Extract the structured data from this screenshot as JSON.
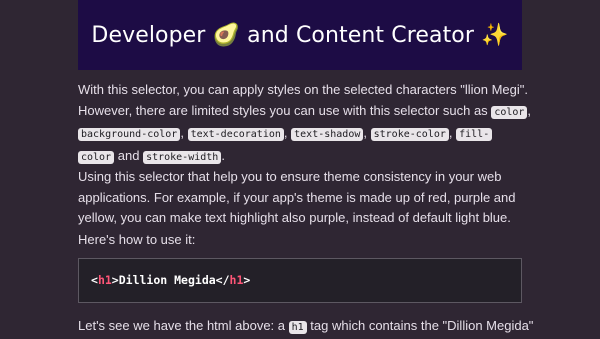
{
  "hero": {
    "title_before": "Developer",
    "emoji_avocado": "🥑",
    "title_middle": "and Content Creator",
    "emoji_sparkles": "✨"
  },
  "p1": {
    "line1": "With this selector, you can apply styles on the selected characters \"llion Megi\".",
    "line2_text": "However, there are limited styles you can use with this selector such as",
    "code_color": "color",
    "comma": ",",
    "code_bg": "background-color",
    "code_decor": "text-decoration",
    "code_shadow": "text-shadow",
    "code_stroke": "stroke-color",
    "code_fill_a": "fill-",
    "code_fill_b": "color",
    "and": "and",
    "code_stroke_width": "stroke-width",
    "period": "."
  },
  "p2": {
    "line1": "Using this selector that help you to ensure theme consistency in your web",
    "line2": "applications. For example, if your app's theme is made up of red, purple and",
    "line3": "yellow, you can make text highlight also purple, instead of default light blue."
  },
  "p3": {
    "text": "Here's how to use it:"
  },
  "code_block": {
    "open_lt": "<",
    "open_tag": "h1",
    "open_gt": ">",
    "content": "Dillion Megida",
    "close_lt": "</",
    "close_tag": "h1",
    "close_gt": ">"
  },
  "p4": {
    "text_before": "Let's see we have the html above: a",
    "code_h1": "h1",
    "text_after": "tag which contains the \"Dillion Megida\""
  }
}
